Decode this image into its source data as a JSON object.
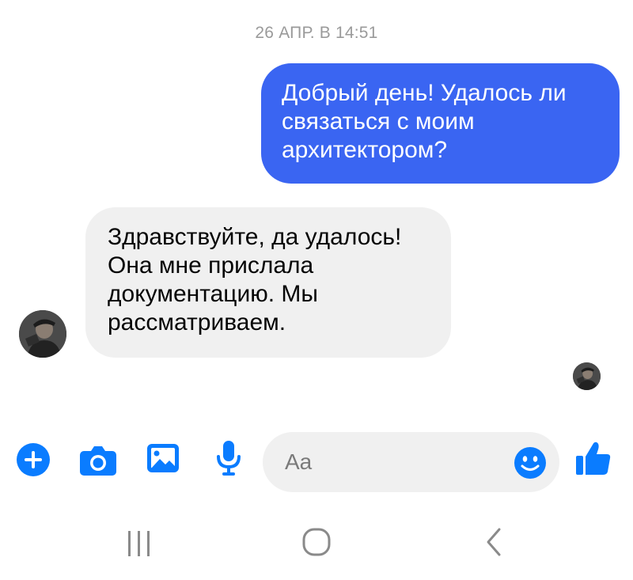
{
  "chat": {
    "timestamp": "26 АПР. В 14:51",
    "messages": [
      {
        "direction": "outgoing",
        "text": "Добрый день! Удалось ли связаться с моим архитектором?"
      },
      {
        "direction": "incoming",
        "text": "Здравствуйте, да удалось! Она мне прислала документацию. Мы рассматриваем."
      }
    ]
  },
  "composer": {
    "placeholder": "Aa"
  },
  "icons": {
    "add": "plus-circle-icon",
    "camera": "camera-icon",
    "gallery": "image-icon",
    "voice": "microphone-icon",
    "emoji": "smiley-icon",
    "like": "thumbs-up-icon",
    "nav_recent": "recent-apps-icon",
    "nav_home": "home-icon",
    "nav_back": "back-chevron-icon"
  },
  "colors": {
    "accent": "#0a7cff",
    "outgoing_bubble": "#3a65f2",
    "incoming_bubble": "#f0f0f0",
    "timestamp": "#9a9a9a"
  }
}
